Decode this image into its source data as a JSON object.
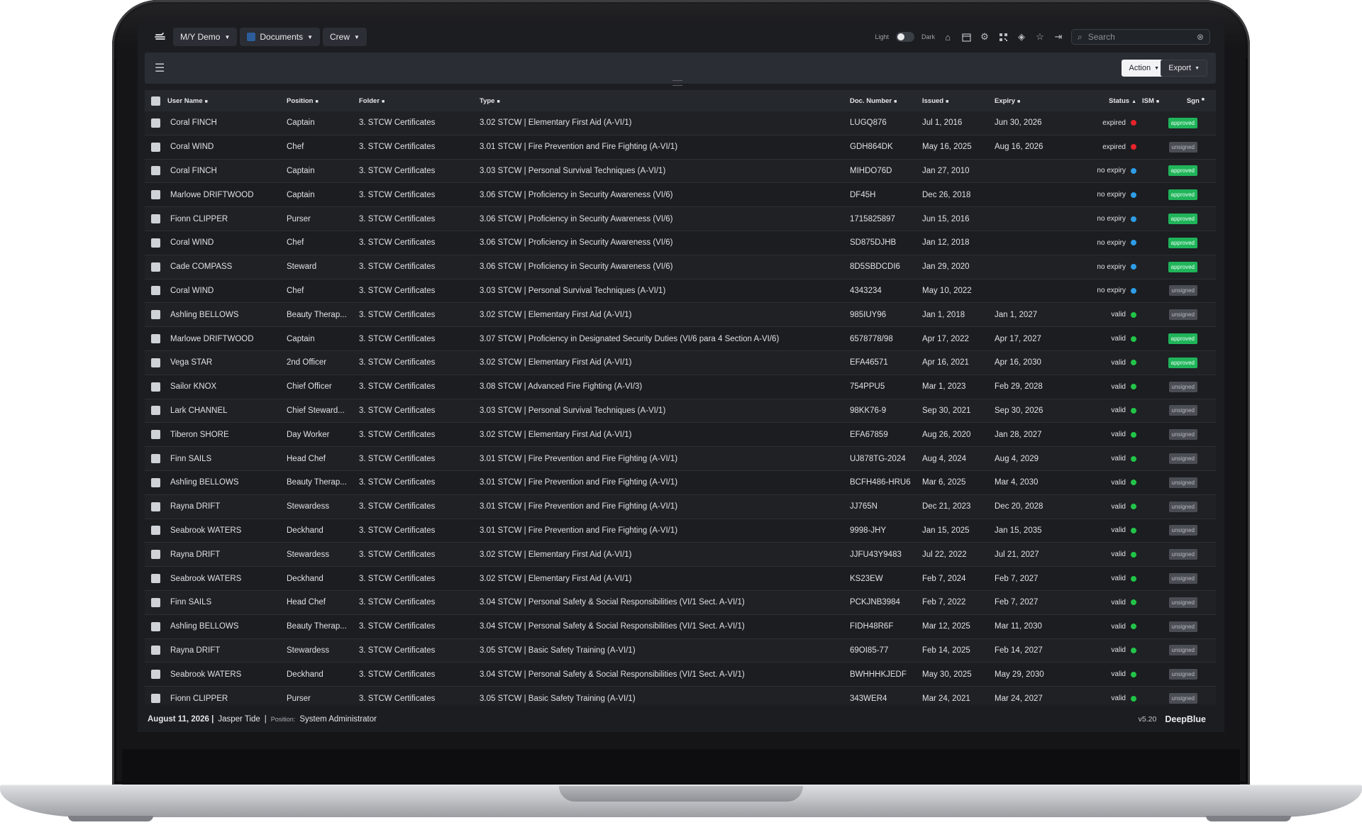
{
  "nav": {
    "vessel": "M/Y Demo",
    "module": "Documents",
    "section": "Crew",
    "mode_light": "Light",
    "mode_dark": "Dark",
    "search_placeholder": "Search"
  },
  "toolbar": {
    "action_label": "Action",
    "export_label": "Export"
  },
  "columns": {
    "user": "User Name",
    "position": "Position",
    "folder": "Folder",
    "type": "Type",
    "doc": "Doc. Number",
    "issued": "Issued",
    "expiry": "Expiry",
    "status": "Status",
    "ism": "ISM",
    "sgn": "Sgn"
  },
  "colors": {
    "approved": "#20b45a",
    "expired": "#e5242b",
    "noexpiry": "#2f9de8",
    "valid": "#22c447"
  },
  "rows": [
    {
      "user": "Coral FINCH",
      "position": "Captain",
      "folder": "3. STCW Certificates",
      "type": "3.02 STCW | Elementary First Aid (A-VI/1)",
      "doc": "LUGQ876",
      "issued": "Jul 1, 2016",
      "expiry": "Jun 30, 2026",
      "status": "expired",
      "sgn": "approved"
    },
    {
      "user": "Coral WIND",
      "position": "Chef",
      "folder": "3. STCW Certificates",
      "type": "3.01 STCW | Fire Prevention and Fire Fighting (A-VI/1)",
      "doc": "GDH864DK",
      "issued": "May 16, 2025",
      "expiry": "Aug 16, 2026",
      "status": "expired",
      "sgn": "unsigned"
    },
    {
      "user": "Coral FINCH",
      "position": "Captain",
      "folder": "3. STCW Certificates",
      "type": "3.03 STCW | Personal Survival Techniques (A-VI/1)",
      "doc": "MIHDO76D",
      "issued": "Jan 27, 2010",
      "expiry": "",
      "status": "no expiry",
      "sgn": "approved"
    },
    {
      "user": "Marlowe DRIFTWOOD",
      "position": "Captain",
      "folder": "3. STCW Certificates",
      "type": "3.06 STCW | Proficiency in Security Awareness (VI/6)",
      "doc": "DF45H",
      "issued": "Dec 26, 2018",
      "expiry": "",
      "status": "no expiry",
      "sgn": "approved"
    },
    {
      "user": "Fionn CLIPPER",
      "position": "Purser",
      "folder": "3. STCW Certificates",
      "type": "3.06 STCW | Proficiency in Security Awareness (VI/6)",
      "doc": "1715825897",
      "issued": "Jun 15, 2016",
      "expiry": "",
      "status": "no expiry",
      "sgn": "approved"
    },
    {
      "user": "Coral WIND",
      "position": "Chef",
      "folder": "3. STCW Certificates",
      "type": "3.06 STCW | Proficiency in Security Awareness (VI/6)",
      "doc": "SD875DJHB",
      "issued": "Jan 12, 2018",
      "expiry": "",
      "status": "no expiry",
      "sgn": "approved"
    },
    {
      "user": "Cade COMPASS",
      "position": "Steward",
      "folder": "3. STCW Certificates",
      "type": "3.06 STCW | Proficiency in Security Awareness (VI/6)",
      "doc": "8D5SBDCDI6",
      "issued": "Jan 29, 2020",
      "expiry": "",
      "status": "no expiry",
      "sgn": "approved"
    },
    {
      "user": "Coral WIND",
      "position": "Chef",
      "folder": "3. STCW Certificates",
      "type": "3.03 STCW | Personal Survival Techniques (A-VI/1)",
      "doc": "4343234",
      "issued": "May 10, 2022",
      "expiry": "",
      "status": "no expiry",
      "sgn": "unsigned"
    },
    {
      "user": "Ashling BELLOWS",
      "position": "Beauty Therap...",
      "folder": "3. STCW Certificates",
      "type": "3.02 STCW | Elementary First Aid (A-VI/1)",
      "doc": "985IUY96",
      "issued": "Jan 1, 2018",
      "expiry": "Jan 1, 2027",
      "status": "valid",
      "sgn": "unsigned"
    },
    {
      "user": "Marlowe DRIFTWOOD",
      "position": "Captain",
      "folder": "3. STCW Certificates",
      "type": "3.07 STCW | Proficiency in Designated Security Duties (VI/6 para 4 Section A-VI/6)",
      "doc": "6578778/98",
      "issued": "Apr 17, 2022",
      "expiry": "Apr 17, 2027",
      "status": "valid",
      "sgn": "approved"
    },
    {
      "user": "Vega STAR",
      "position": "2nd Officer",
      "folder": "3. STCW Certificates",
      "type": "3.02 STCW | Elementary First Aid (A-VI/1)",
      "doc": "EFA46571",
      "issued": "Apr 16, 2021",
      "expiry": "Apr 16, 2030",
      "status": "valid",
      "sgn": "approved"
    },
    {
      "user": "Sailor KNOX",
      "position": "Chief Officer",
      "folder": "3. STCW Certificates",
      "type": "3.08 STCW | Advanced Fire Fighting (A-VI/3)",
      "doc": "754PPU5",
      "issued": "Mar 1, 2023",
      "expiry": "Feb 29, 2028",
      "status": "valid",
      "sgn": "unsigned"
    },
    {
      "user": "Lark CHANNEL",
      "position": "Chief Steward...",
      "folder": "3. STCW Certificates",
      "type": "3.03 STCW | Personal Survival Techniques (A-VI/1)",
      "doc": "98KK76-9",
      "issued": "Sep 30, 2021",
      "expiry": "Sep 30, 2026",
      "status": "valid",
      "sgn": "unsigned"
    },
    {
      "user": "Tiberon SHORE",
      "position": "Day Worker",
      "folder": "3. STCW Certificates",
      "type": "3.02 STCW | Elementary First Aid (A-VI/1)",
      "doc": "EFA67859",
      "issued": "Aug 26, 2020",
      "expiry": "Jan 28, 2027",
      "status": "valid",
      "sgn": "unsigned"
    },
    {
      "user": "Finn SAILS",
      "position": "Head Chef",
      "folder": "3. STCW Certificates",
      "type": "3.01 STCW | Fire Prevention and Fire Fighting (A-VI/1)",
      "doc": "UJ878TG-2024",
      "issued": "Aug 4, 2024",
      "expiry": "Aug 4, 2029",
      "status": "valid",
      "sgn": "unsigned"
    },
    {
      "user": "Ashling BELLOWS",
      "position": "Beauty Therap...",
      "folder": "3. STCW Certificates",
      "type": "3.01 STCW | Fire Prevention and Fire Fighting (A-VI/1)",
      "doc": "BCFH486-HRU6",
      "issued": "Mar 6, 2025",
      "expiry": "Mar 4, 2030",
      "status": "valid",
      "sgn": "unsigned"
    },
    {
      "user": "Rayna DRIFT",
      "position": "Stewardess",
      "folder": "3. STCW Certificates",
      "type": "3.01 STCW | Fire Prevention and Fire Fighting (A-VI/1)",
      "doc": "JJ765N",
      "issued": "Dec 21, 2023",
      "expiry": "Dec 20, 2028",
      "status": "valid",
      "sgn": "unsigned"
    },
    {
      "user": "Seabrook WATERS",
      "position": "Deckhand",
      "folder": "3. STCW Certificates",
      "type": "3.01 STCW | Fire Prevention and Fire Fighting (A-VI/1)",
      "doc": "9998-JHY",
      "issued": "Jan 15, 2025",
      "expiry": "Jan 15, 2035",
      "status": "valid",
      "sgn": "unsigned"
    },
    {
      "user": "Rayna DRIFT",
      "position": "Stewardess",
      "folder": "3. STCW Certificates",
      "type": "3.02 STCW | Elementary First Aid (A-VI/1)",
      "doc": "JJFU43Y9483",
      "issued": "Jul 22, 2022",
      "expiry": "Jul 21, 2027",
      "status": "valid",
      "sgn": "unsigned"
    },
    {
      "user": "Seabrook WATERS",
      "position": "Deckhand",
      "folder": "3. STCW Certificates",
      "type": "3.02 STCW | Elementary First Aid (A-VI/1)",
      "doc": "KS23EW",
      "issued": "Feb 7, 2024",
      "expiry": "Feb 7, 2027",
      "status": "valid",
      "sgn": "unsigned"
    },
    {
      "user": "Finn SAILS",
      "position": "Head Chef",
      "folder": "3. STCW Certificates",
      "type": "3.04 STCW | Personal Safety & Social Responsibilities (VI/1 Sect. A-VI/1)",
      "doc": "PCKJNB3984",
      "issued": "Feb 7, 2022",
      "expiry": "Feb 7, 2027",
      "status": "valid",
      "sgn": "unsigned"
    },
    {
      "user": "Ashling BELLOWS",
      "position": "Beauty Therap...",
      "folder": "3. STCW Certificates",
      "type": "3.04 STCW | Personal Safety & Social Responsibilities (VI/1 Sect. A-VI/1)",
      "doc": "FIDH48R6F",
      "issued": "Mar 12, 2025",
      "expiry": "Mar 11, 2030",
      "status": "valid",
      "sgn": "unsigned"
    },
    {
      "user": "Rayna DRIFT",
      "position": "Stewardess",
      "folder": "3. STCW Certificates",
      "type": "3.05 STCW | Basic Safety Training (A-VI/1)",
      "doc": "69OI85-77",
      "issued": "Feb 14, 2025",
      "expiry": "Feb 14, 2027",
      "status": "valid",
      "sgn": "unsigned"
    },
    {
      "user": "Seabrook WATERS",
      "position": "Deckhand",
      "folder": "3. STCW Certificates",
      "type": "3.04 STCW | Personal Safety & Social Responsibilities (VI/1 Sect. A-VI/1)",
      "doc": "BWHHHKJEDF",
      "issued": "May 30, 2025",
      "expiry": "May 29, 2030",
      "status": "valid",
      "sgn": "unsigned"
    },
    {
      "user": "Fionn CLIPPER",
      "position": "Purser",
      "folder": "3. STCW Certificates",
      "type": "3.05 STCW | Basic Safety Training (A-VI/1)",
      "doc": "343WER4",
      "issued": "Mar 24, 2021",
      "expiry": "Mar 24, 2027",
      "status": "valid",
      "sgn": "unsigned"
    }
  ],
  "footer": {
    "date": "August 11, 2026 |",
    "user": "Jasper Tide",
    "sep": "|",
    "position_label": "Position:",
    "position": "System Administrator",
    "version": "v5.20",
    "brand": "DeepBlue"
  }
}
